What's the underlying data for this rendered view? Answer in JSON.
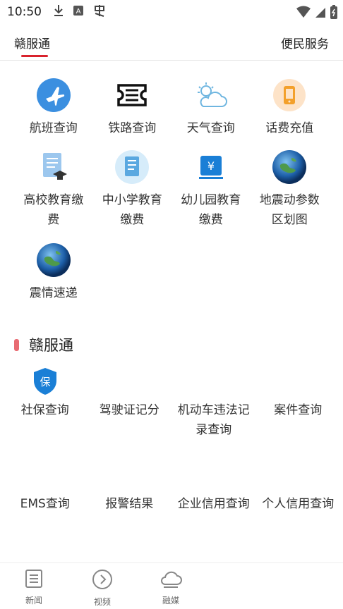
{
  "status_bar": {
    "time": "10:50",
    "icons_left": [
      "download-icon",
      "app-a-icon",
      "notification-icon"
    ],
    "icons_right": [
      "wifi-icon",
      "signal-icon",
      "battery-icon"
    ]
  },
  "tabs": {
    "left": "赣服通",
    "right": "便民服务"
  },
  "services": [
    {
      "label": "航班查询",
      "icon": "airplane-icon"
    },
    {
      "label": "铁路查询",
      "icon": "train-ticket-icon"
    },
    {
      "label": "天气查询",
      "icon": "weather-icon"
    },
    {
      "label": "话费充值",
      "icon": "phone-recharge-icon"
    },
    {
      "label": "高校教育缴费",
      "icon": "university-icon"
    },
    {
      "label": "中小学教育缴费",
      "icon": "school-icon"
    },
    {
      "label": "幼儿园教育缴费",
      "icon": "kindergarten-icon"
    },
    {
      "label": "地震动参数区划图",
      "icon": "earth-icon"
    },
    {
      "label": "震情速递",
      "icon": "earth-icon"
    }
  ],
  "section": {
    "title": "赣服通"
  },
  "gov_services": [
    {
      "label": "社保查询",
      "icon": "shield-insurance-icon"
    },
    {
      "label": "驾驶证记分",
      "icon": ""
    },
    {
      "label": "机动车违法记录查询",
      "icon": ""
    },
    {
      "label": "案件查询",
      "icon": ""
    },
    {
      "label": "EMS查询",
      "icon": ""
    },
    {
      "label": "报警结果",
      "icon": ""
    },
    {
      "label": "企业信用查询",
      "icon": ""
    },
    {
      "label": "个人信用查询",
      "icon": ""
    }
  ],
  "bottom_nav": [
    {
      "label": "新闻",
      "icon": "news-icon"
    },
    {
      "label": "视频",
      "icon": "video-icon"
    },
    {
      "label": "融媒",
      "icon": "cloud-icon"
    }
  ],
  "colors": {
    "accent": "#d9232d",
    "section_bar": "#e86b72",
    "airplane": "#3b8fe0",
    "recharge": "#f3a02b",
    "shield": "#1a7fd6"
  }
}
